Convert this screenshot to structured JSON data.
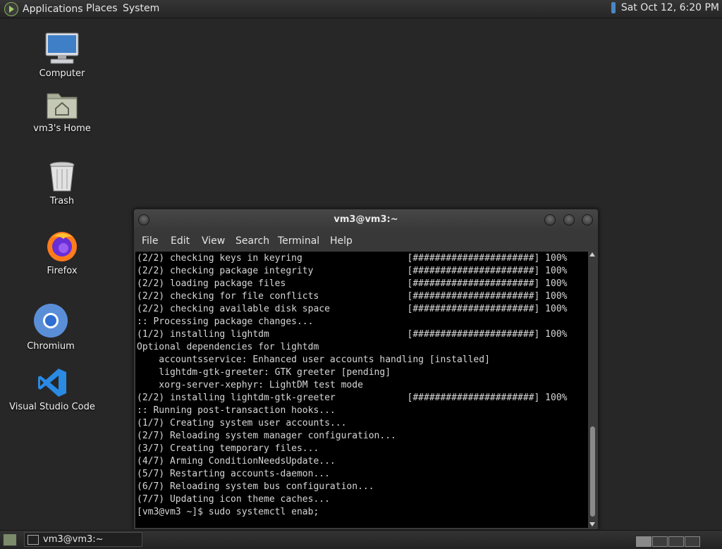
{
  "top_panel": {
    "menus": [
      "Applications",
      "Places",
      "System"
    ],
    "clock": "Sat Oct 12,  6:20 PM"
  },
  "desktop_icons": [
    {
      "label": "Computer",
      "icon": "computer-icon"
    },
    {
      "label": "vm3's Home",
      "icon": "home-folder-icon"
    },
    {
      "label": "Trash",
      "icon": "trash-icon"
    },
    {
      "label": "Firefox",
      "icon": "firefox-icon"
    },
    {
      "label": "Chromium",
      "icon": "chromium-icon"
    },
    {
      "label": "Visual Studio Code",
      "icon": "vscode-icon"
    }
  ],
  "terminal": {
    "title": "vm3@vm3:~",
    "menu": [
      "File",
      "Edit",
      "View",
      "Search",
      "Terminal",
      "Help"
    ],
    "lines": [
      "(2/2) checking keys in keyring                   [######################] 100%",
      "(2/2) checking package integrity                 [######################] 100%",
      "(2/2) loading package files                      [######################] 100%",
      "(2/2) checking for file conflicts                [######################] 100%",
      "(2/2) checking available disk space              [######################] 100%",
      ":: Processing package changes...",
      "(1/2) installing lightdm                         [######################] 100%",
      "Optional dependencies for lightdm",
      "    accountsservice: Enhanced user accounts handling [installed]",
      "    lightdm-gtk-greeter: GTK greeter [pending]",
      "    xorg-server-xephyr: LightDM test mode",
      "(2/2) installing lightdm-gtk-greeter             [######################] 100%",
      ":: Running post-transaction hooks...",
      "(1/7) Creating system user accounts...",
      "(2/7) Reloading system manager configuration...",
      "(3/7) Creating temporary files...",
      "(4/7) Arming ConditionNeedsUpdate...",
      "(5/7) Restarting accounts-daemon...",
      "(6/7) Reloading system bus configuration...",
      "(7/7) Updating icon theme caches...",
      "[vm3@vm3 ~]$ sudo systemctl enab;"
    ]
  },
  "taskbar": {
    "task_label": "vm3@vm3:~"
  }
}
